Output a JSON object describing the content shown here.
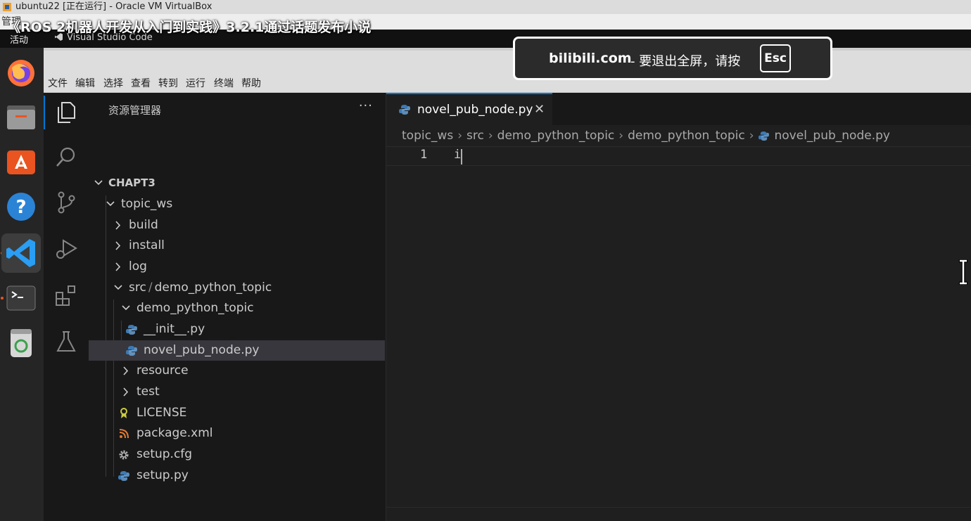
{
  "host_window": {
    "title": "ubuntu22 [正在运行] - Oracle VM VirtualBox",
    "menu_visible_text": "管理"
  },
  "video_overlay": {
    "title": "《ROS 2机器人开发从入门到实践》3.2.1通过话题发布小说"
  },
  "ubuntu_panel": {
    "activities": "活动",
    "app_name": "Visual Studio Code"
  },
  "dock": {
    "items": [
      "firefox-icon",
      "files-icon",
      "app-center-icon",
      "help-icon",
      "vscode-icon",
      "terminal-icon",
      "trash-icon"
    ]
  },
  "menubar": {
    "items": [
      "文件",
      "编辑",
      "选择",
      "查看",
      "转到",
      "运行",
      "终端",
      "帮助"
    ]
  },
  "explorer": {
    "title": "资源管理器",
    "more": "···",
    "root": "CHAPT3",
    "tree": [
      {
        "label": "topic_ws",
        "type": "folder",
        "open": true
      },
      {
        "label": "build",
        "type": "folder",
        "open": false
      },
      {
        "label": "install",
        "type": "folder",
        "open": false
      },
      {
        "label": "log",
        "type": "folder",
        "open": false
      },
      {
        "label": "src",
        "label_suffix": "demo_python_topic",
        "type": "folder",
        "open": true
      },
      {
        "label": "demo_python_topic",
        "type": "folder",
        "open": true
      },
      {
        "label": "__init__.py",
        "type": "python"
      },
      {
        "label": "novel_pub_node.py",
        "type": "python",
        "selected": true
      },
      {
        "label": "resource",
        "type": "folder",
        "open": false
      },
      {
        "label": "test",
        "type": "folder",
        "open": false
      },
      {
        "label": "LICENSE",
        "type": "license"
      },
      {
        "label": "package.xml",
        "type": "xml"
      },
      {
        "label": "setup.cfg",
        "type": "gear"
      },
      {
        "label": "setup.py",
        "type": "python"
      }
    ]
  },
  "editor": {
    "tab_label": "novel_pub_node.py",
    "close_glyph": "✕",
    "breadcrumb": [
      "topic_ws",
      "src",
      "demo_python_topic",
      "demo_python_topic",
      "novel_pub_node.py"
    ],
    "line_number": "1",
    "code": "i"
  },
  "notice": {
    "domain": "bilibili.com",
    "message": "- 要退出全屏，请按",
    "key": "Esc"
  },
  "colors": {
    "accent": "#0078d4",
    "ubuntu_orange": "#e95420",
    "python_blue": "#3c7ab5",
    "xml_orange": "#e37933",
    "license_yellow": "#cbcb41"
  }
}
